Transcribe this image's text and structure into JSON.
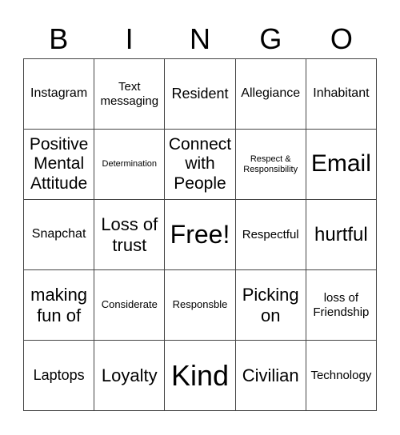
{
  "header": [
    "B",
    "I",
    "N",
    "G",
    "O"
  ],
  "cells": [
    {
      "text": "Instagram",
      "size": "s16"
    },
    {
      "text": "Text messaging",
      "size": "s15"
    },
    {
      "text": "Resident",
      "size": "s18"
    },
    {
      "text": "Allegiance",
      "size": "s16"
    },
    {
      "text": "Inhabitant",
      "size": "s16"
    },
    {
      "text": "Positive Mental Attitude",
      "size": "s21"
    },
    {
      "text": "Determination",
      "size": "s11"
    },
    {
      "text": "Connect with People",
      "size": "s21"
    },
    {
      "text": "Respect & Responsibility",
      "size": "s11"
    },
    {
      "text": "Email",
      "size": "s30"
    },
    {
      "text": "Snapchat",
      "size": "s16"
    },
    {
      "text": "Loss of trust",
      "size": "s22"
    },
    {
      "text": "Free!",
      "size": "s32"
    },
    {
      "text": "Respectful",
      "size": "s15"
    },
    {
      "text": "hurtful",
      "size": "s24"
    },
    {
      "text": "making fun of",
      "size": "s22"
    },
    {
      "text": "Considerate",
      "size": "s13"
    },
    {
      "text": "Responsble",
      "size": "s13"
    },
    {
      "text": "Picking on",
      "size": "s22"
    },
    {
      "text": "loss of Friendship",
      "size": "s15"
    },
    {
      "text": "Laptops",
      "size": "s18"
    },
    {
      "text": "Loyalty",
      "size": "s22"
    },
    {
      "text": "Kind",
      "size": "s36"
    },
    {
      "text": "Civilian",
      "size": "s22"
    },
    {
      "text": "Technology",
      "size": "s15"
    }
  ]
}
